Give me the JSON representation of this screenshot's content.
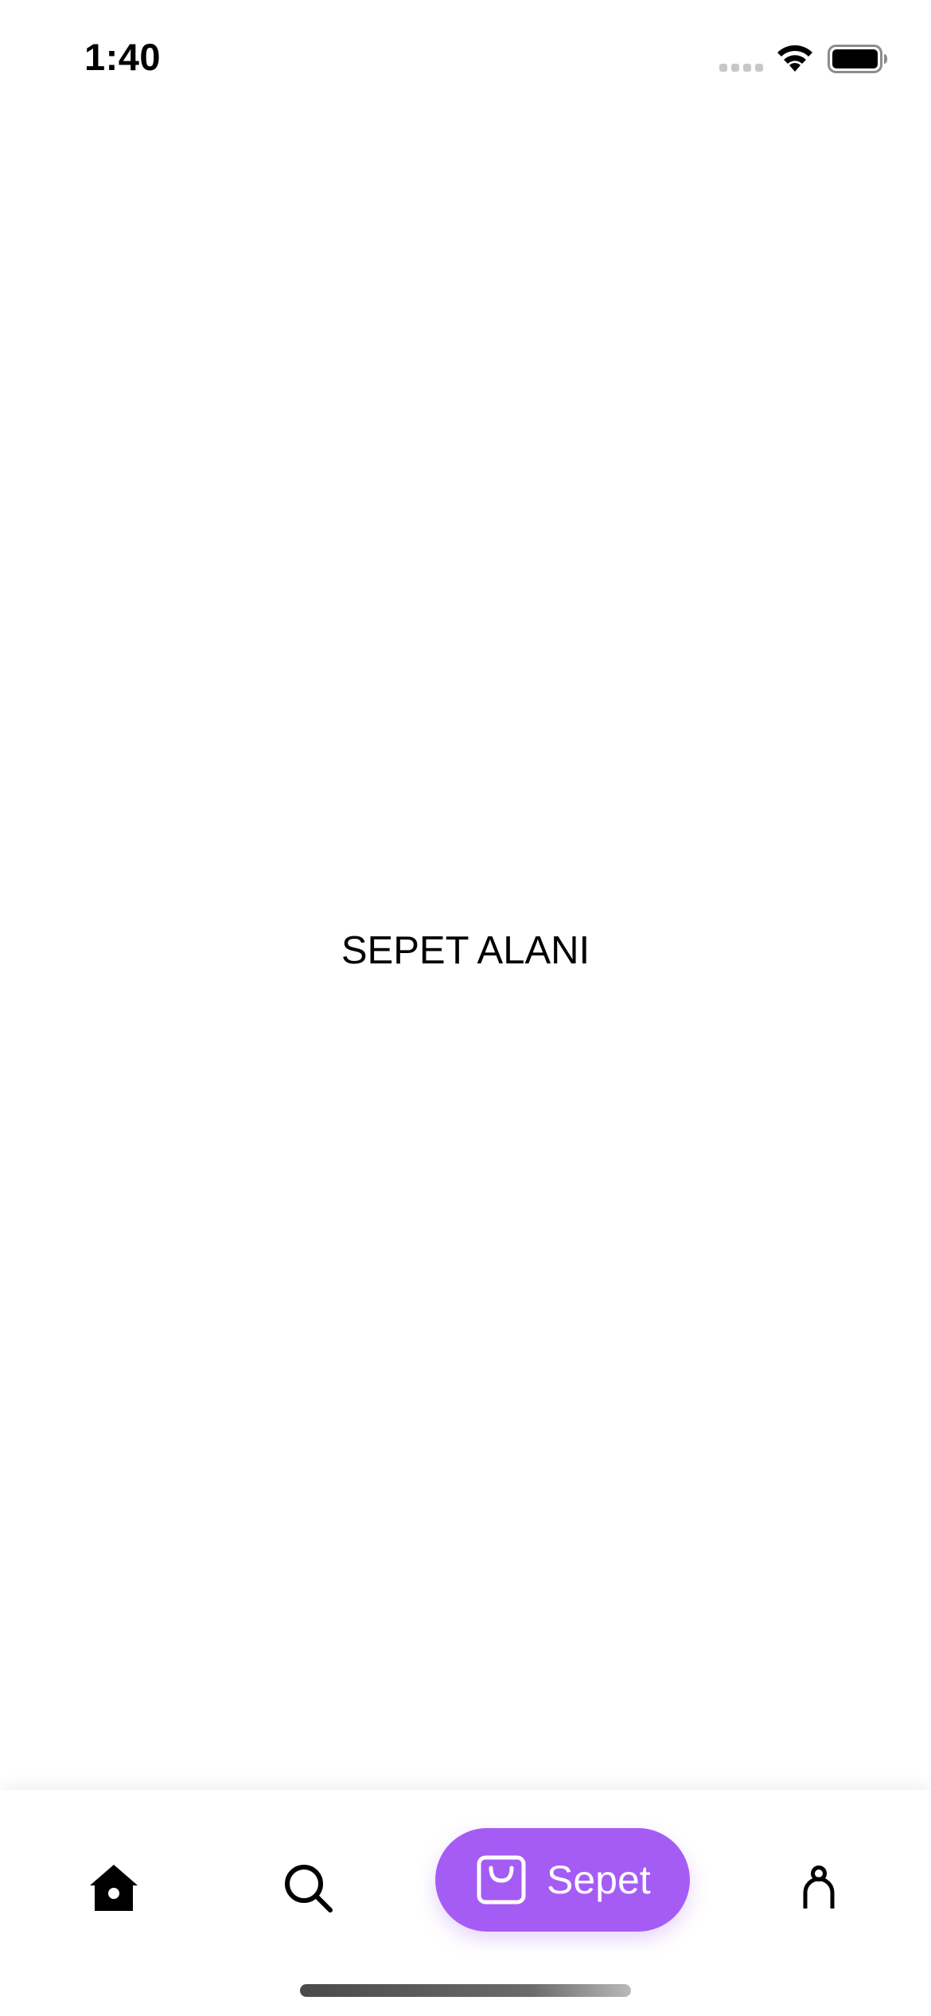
{
  "status_bar": {
    "time": "1:40",
    "signal_icon": "signal-bars-icon",
    "wifi_icon": "wifi-icon",
    "battery_icon": "battery-icon"
  },
  "main": {
    "title": "SEPET ALANI"
  },
  "tab_bar": {
    "items": [
      {
        "id": "home",
        "icon": "home-icon",
        "label": "",
        "active": false
      },
      {
        "id": "search",
        "icon": "search-icon",
        "label": "",
        "active": false
      },
      {
        "id": "cart",
        "icon": "shopping-bag-icon",
        "label": "Sepet",
        "active": true
      },
      {
        "id": "profile",
        "icon": "person-icon",
        "label": "",
        "active": false
      }
    ],
    "active_color": "#a55cf5"
  }
}
